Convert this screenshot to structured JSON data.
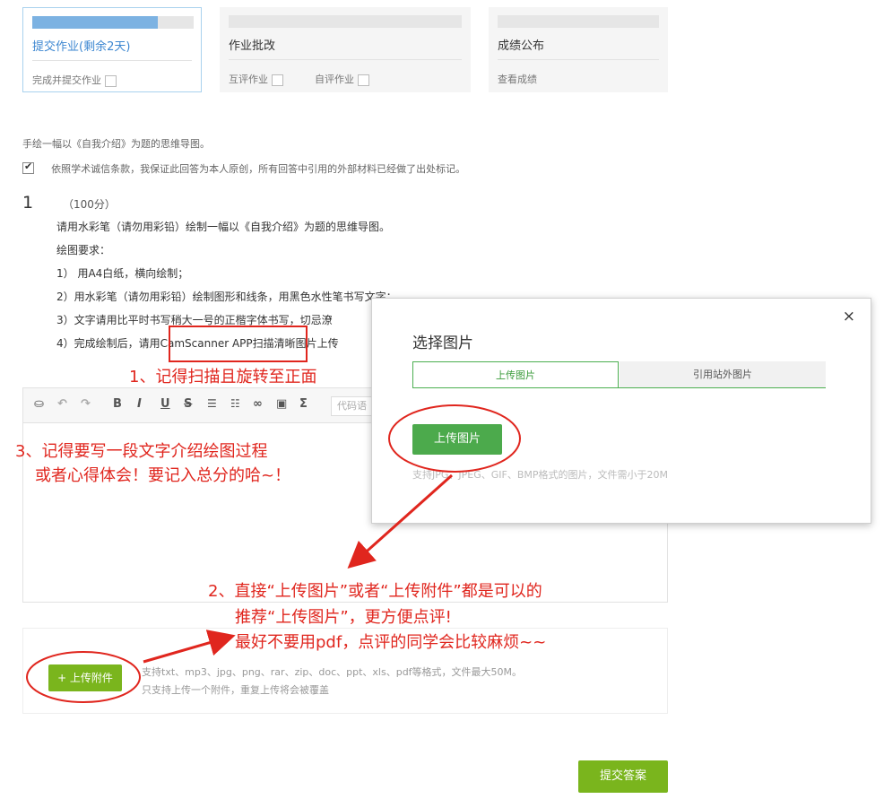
{
  "steps": [
    {
      "title": "提交作业(剩余2天)",
      "progress": 0.78,
      "subs": [
        {
          "label": "完成并提交作业"
        }
      ]
    },
    {
      "title": "作业批改",
      "progress": 0,
      "subs": [
        {
          "label": "互评作业"
        },
        {
          "label": "自评作业"
        }
      ]
    },
    {
      "title": "成绩公布",
      "progress": 0,
      "subs": [
        {
          "label": "查看成绩"
        }
      ]
    }
  ],
  "intro": "手绘一幅以《自我介绍》为题的思维导图。",
  "integrity": "依照学术诚信条款，我保证此回答为本人原创，所有回答中引用的外部材料已经做了出处标记。",
  "question": {
    "number": "1",
    "score": "（100分）",
    "lines": [
      "请用水彩笔（请勿用彩铅）绘制一幅以《自我介绍》为题的思维导图。",
      "绘图要求：",
      "1） 用A4白纸，横向绘制；",
      "2）用水彩笔（请勿用彩铅）绘制图形和线条，用黑色水性笔书写文字；",
      "3）文字请用比平时书写稍大一号的正楷字体书写，切忌潦",
      "4）完成绘制后，请用CamScanner APP扫描清晰图片上传"
    ]
  },
  "editor": {
    "code_placeholder": "代码语"
  },
  "attach": {
    "button": "+ 上传附件",
    "hint1": "支持txt、mp3、jpg、png、rar、zip、doc、ppt、xls、pdf等格式，文件最大50M。",
    "hint2": "只支持上传一个附件，重复上传将会被覆盖"
  },
  "submit": "提交答案",
  "modal": {
    "close": "×",
    "title": "选择图片",
    "tab_upload": "上传图片",
    "tab_external": "引用站外图片",
    "upload_button": "上传图片",
    "hint": "支持JPG、JPEG、GIF、BMP格式的图片，文件需小于20M"
  },
  "annotations": {
    "a1": "1、记得扫描且旋转至正面",
    "a3_line1": "3、记得要写一段文字介绍绘图过程",
    "a3_line2": "或者心得体会！要记入总分的哈~！",
    "a2_line1": "2、直接“上传图片”或者“上传附件”都是可以的",
    "a2_line2": "推荐“上传图片”，更方便点评!",
    "a2_line3": "最好不要用pdf，点评的同学会比较麻烦~~"
  },
  "colors": {
    "annotation_red": "#e0261e",
    "green": "#7ab51d",
    "blue": "#3d87d1"
  }
}
